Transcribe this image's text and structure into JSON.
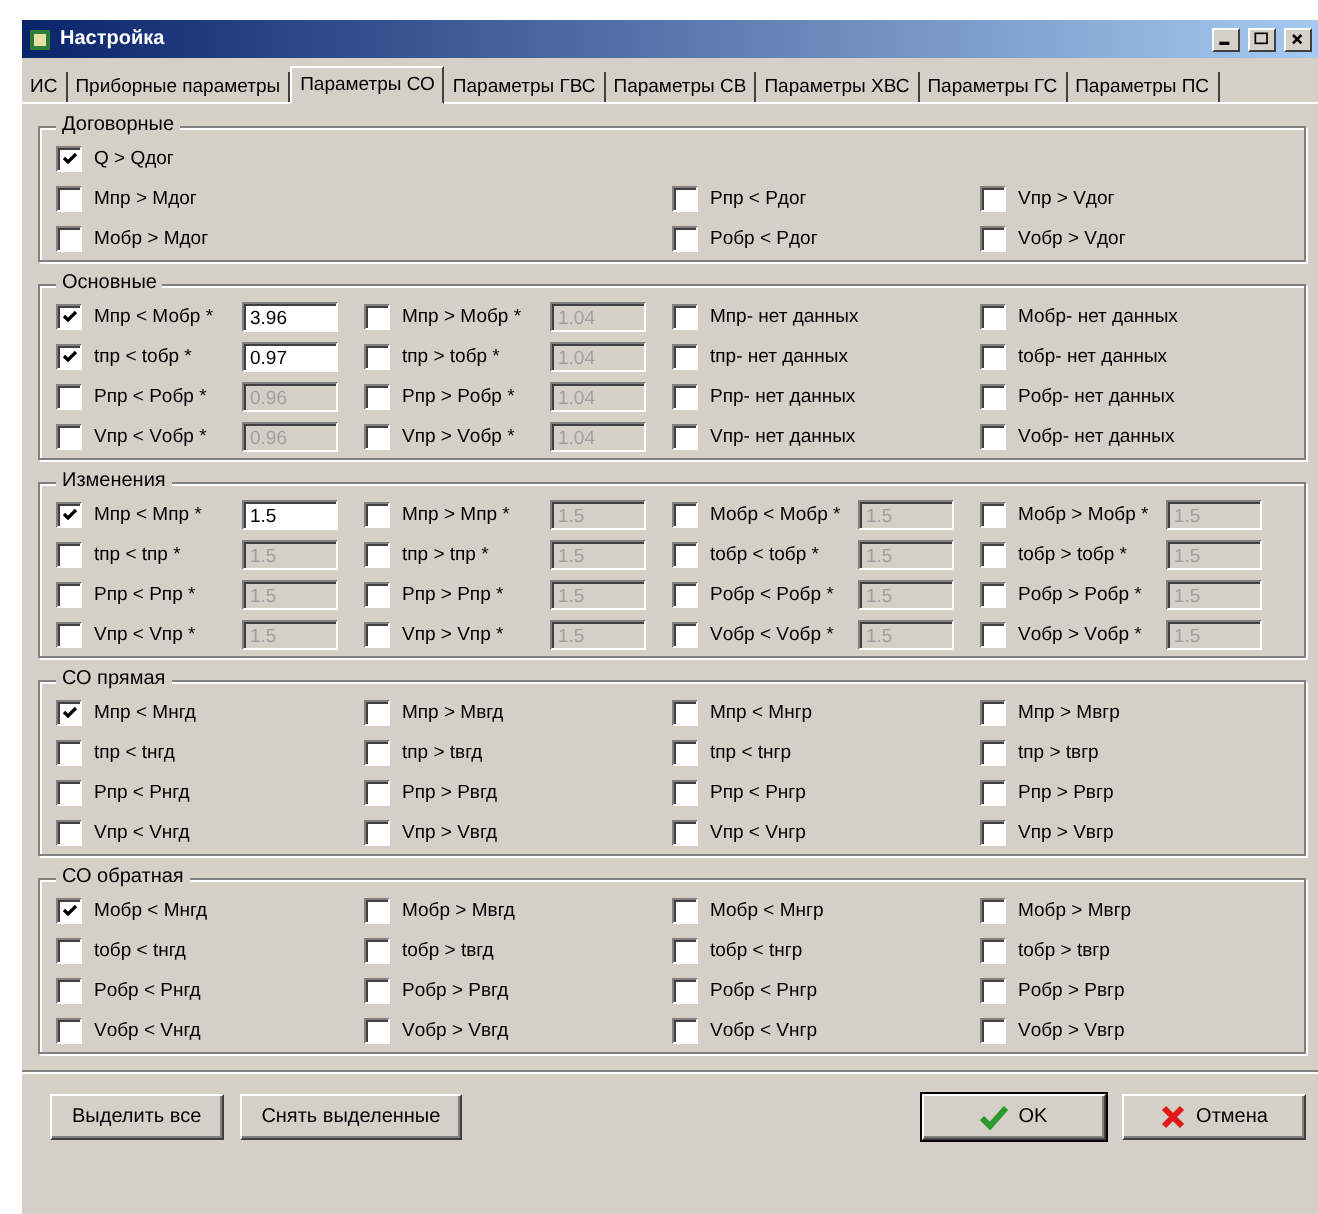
{
  "window": {
    "title": "Настройка"
  },
  "tabs": [
    {
      "label": "ИС",
      "selected": false
    },
    {
      "label": "Приборные параметры",
      "selected": false
    },
    {
      "label": "Параметры СО",
      "selected": true
    },
    {
      "label": "Параметры ГВС",
      "selected": false
    },
    {
      "label": "Параметры СВ",
      "selected": false
    },
    {
      "label": "Параметры ХВС",
      "selected": false
    },
    {
      "label": "Параметры ГС",
      "selected": false
    },
    {
      "label": "Параметры ПС",
      "selected": false
    }
  ],
  "groups": [
    {
      "title": "Договорные",
      "rows": [
        [
          {
            "label": "Q > Qдог",
            "checked": true
          },
          null,
          null,
          null
        ],
        [
          {
            "label": "Мпр > Мдог",
            "checked": false
          },
          null,
          {
            "label": "Pпр < Pдог",
            "checked": false
          },
          {
            "label": "Vпр > Vдог",
            "checked": false
          }
        ],
        [
          {
            "label": "Мобр > Мдог",
            "checked": false
          },
          null,
          {
            "label": "Pобр < Pдог",
            "checked": false
          },
          {
            "label": "Vобр > Vдог",
            "checked": false
          }
        ]
      ]
    },
    {
      "title": "Основные",
      "rows": [
        [
          {
            "label": "Мпр < Мобр *",
            "checked": true,
            "value": "3.96"
          },
          {
            "label": "Мпр > Мобр *",
            "checked": false,
            "value": "1.04"
          },
          {
            "label": "Мпр- нет данных",
            "checked": false
          },
          {
            "label": "Мобр- нет данных",
            "checked": false
          }
        ],
        [
          {
            "label": "tпр < tобр *",
            "checked": true,
            "value": "0.97"
          },
          {
            "label": "tпр > tобр *",
            "checked": false,
            "value": "1.04"
          },
          {
            "label": "tпр- нет данных",
            "checked": false
          },
          {
            "label": "tобр- нет данных",
            "checked": false
          }
        ],
        [
          {
            "label": "Pпр < Pобр *",
            "checked": false,
            "value": "0.96"
          },
          {
            "label": "Pпр > Pобр *",
            "checked": false,
            "value": "1.04"
          },
          {
            "label": "Pпр- нет данных",
            "checked": false
          },
          {
            "label": "Pобр- нет данных",
            "checked": false
          }
        ],
        [
          {
            "label": "Vпр < Vобр *",
            "checked": false,
            "value": "0.96"
          },
          {
            "label": "Vпр > Vобр *",
            "checked": false,
            "value": "1.04"
          },
          {
            "label": "Vпр- нет данных",
            "checked": false
          },
          {
            "label": "Vобр- нет данных",
            "checked": false
          }
        ]
      ]
    },
    {
      "title": "Изменения",
      "rows": [
        [
          {
            "label": "Мпр < Мпр *",
            "checked": true,
            "value": "1.5"
          },
          {
            "label": "Мпр > Мпр *",
            "checked": false,
            "value": "1.5"
          },
          {
            "label": "Мобр < Мобр *",
            "checked": false,
            "value": "1.5"
          },
          {
            "label": "Мобр > Мобр *",
            "checked": false,
            "value": "1.5"
          }
        ],
        [
          {
            "label": "tпр < tпр *",
            "checked": false,
            "value": "1.5"
          },
          {
            "label": "tпр > tпр *",
            "checked": false,
            "value": "1.5"
          },
          {
            "label": "tобр < tобр *",
            "checked": false,
            "value": "1.5"
          },
          {
            "label": "tобр > tобр *",
            "checked": false,
            "value": "1.5"
          }
        ],
        [
          {
            "label": "Pпр < Pпр *",
            "checked": false,
            "value": "1.5"
          },
          {
            "label": "Pпр > Pпр *",
            "checked": false,
            "value": "1.5"
          },
          {
            "label": "Pобр < Pобр *",
            "checked": false,
            "value": "1.5"
          },
          {
            "label": "Pобр > Pобр *",
            "checked": false,
            "value": "1.5"
          }
        ],
        [
          {
            "label": "Vпр < Vпр *",
            "checked": false,
            "value": "1.5"
          },
          {
            "label": "Vпр > Vпр *",
            "checked": false,
            "value": "1.5"
          },
          {
            "label": "Vобр < Vобр *",
            "checked": false,
            "value": "1.5"
          },
          {
            "label": "Vобр > Vобр *",
            "checked": false,
            "value": "1.5"
          }
        ]
      ]
    },
    {
      "title": "СО прямая",
      "rows": [
        [
          {
            "label": "Мпр < Мнгд",
            "checked": true
          },
          {
            "label": "Мпр > Мвгд",
            "checked": false
          },
          {
            "label": "Мпр < Мнгр",
            "checked": false
          },
          {
            "label": "Мпр > Мвгр",
            "checked": false
          }
        ],
        [
          {
            "label": "tпр < tнгд",
            "checked": false
          },
          {
            "label": "tпр > tвгд",
            "checked": false
          },
          {
            "label": "tпр < tнгр",
            "checked": false
          },
          {
            "label": "tпр > tвгр",
            "checked": false
          }
        ],
        [
          {
            "label": "Pпр < Pнгд",
            "checked": false
          },
          {
            "label": "Pпр > Pвгд",
            "checked": false
          },
          {
            "label": "Pпр < Pнгр",
            "checked": false
          },
          {
            "label": "Pпр > Pвгр",
            "checked": false
          }
        ],
        [
          {
            "label": "Vпр < Vнгд",
            "checked": false
          },
          {
            "label": "Vпр > Vвгд",
            "checked": false
          },
          {
            "label": "Vпр < Vнгр",
            "checked": false
          },
          {
            "label": "Vпр > Vвгр",
            "checked": false
          }
        ]
      ]
    },
    {
      "title": "СО обратная",
      "rows": [
        [
          {
            "label": "Мобр < Мнгд",
            "checked": true
          },
          {
            "label": "Мобр > Мвгд",
            "checked": false
          },
          {
            "label": "Мобр < Мнгр",
            "checked": false
          },
          {
            "label": "Мобр > Мвгр",
            "checked": false
          }
        ],
        [
          {
            "label": "tобр < tнгд",
            "checked": false
          },
          {
            "label": "tобр > tвгд",
            "checked": false
          },
          {
            "label": "tобр < tнгр",
            "checked": false
          },
          {
            "label": "tобр > tвгр",
            "checked": false
          }
        ],
        [
          {
            "label": "Pобр < Pнгд",
            "checked": false
          },
          {
            "label": "Pобр > Pвгд",
            "checked": false
          },
          {
            "label": "Pобр < Pнгр",
            "checked": false
          },
          {
            "label": "Pобр > Pвгр",
            "checked": false
          }
        ],
        [
          {
            "label": "Vобр < Vнгд",
            "checked": false
          },
          {
            "label": "Vобр > Vвгд",
            "checked": false
          },
          {
            "label": "Vобр < Vнгр",
            "checked": false
          },
          {
            "label": "Vобр > Vвгр",
            "checked": false
          }
        ]
      ]
    }
  ],
  "buttons": [
    {
      "label": "Выделить все",
      "kind": "plain"
    },
    {
      "label": "Снять выделенные",
      "kind": "plain"
    },
    {
      "label": "OK",
      "kind": "ok"
    },
    {
      "label": "Отмена",
      "kind": "cancel"
    }
  ]
}
